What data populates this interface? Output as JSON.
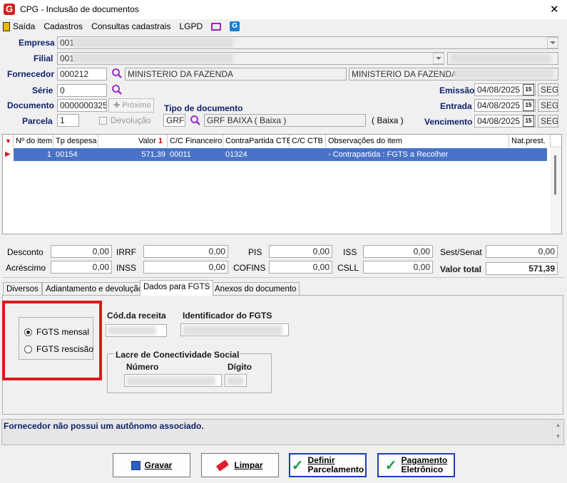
{
  "window": {
    "title": "CPG - Inclusão de documentos",
    "close": "✕"
  },
  "menu": {
    "items": [
      "Saída",
      "Cadastros",
      "Consultas cadastrais",
      "LGPD"
    ]
  },
  "form": {
    "empresa": {
      "label": "Empresa",
      "value": "001"
    },
    "filial": {
      "label": "Filial",
      "value": "001"
    },
    "fornecedor": {
      "label": "Fornecedor",
      "code": "000212",
      "name": "MINISTERIO DA FAZENDA",
      "name2": "MINISTERIO DA FAZENDA -"
    },
    "serie": {
      "label": "Série",
      "value": "0"
    },
    "documento": {
      "label": "Documento",
      "value": "0000000325",
      "proximo": "Próximo"
    },
    "parcela": {
      "label": "Parcela",
      "value": "1",
      "devolucao": "Devolução"
    },
    "tipo": {
      "label": "Tipo de documento",
      "code": "GRF",
      "desc": "GRF BAIXA ( Baixa )",
      "extra": "( Baixa )"
    },
    "emissao": {
      "label": "Emissão",
      "value": "04/08/2025",
      "day": "SEG"
    },
    "entrada": {
      "label": "Entrada",
      "value": "04/08/2025",
      "day": "SEG"
    },
    "vencimento": {
      "label": "Vencimento",
      "value": "04/08/2025",
      "day": "SEG"
    },
    "cal_icon": "15"
  },
  "grid": {
    "headers": [
      "Nº do item",
      "Tp despesa",
      "Valor",
      "C/C Financeiro",
      "ContraPartida CTB",
      "C/C CTB",
      "Observações do item",
      "Nat.prest."
    ],
    "sort_marker": "1",
    "rows": [
      [
        "1",
        "00154",
        "571,39",
        "00011",
        "01324",
        "",
        "- Contrapartida : FGTS a Recolher",
        ""
      ]
    ]
  },
  "totals": {
    "desconto": {
      "label": "Desconto",
      "value": "0,00"
    },
    "acrescimo": {
      "label": "Acréscimo",
      "value": "0,00"
    },
    "irrf": {
      "label": "IRRF",
      "value": "0,00"
    },
    "inss": {
      "label": "INSS",
      "value": "0,00"
    },
    "pis": {
      "label": "PIS",
      "value": "0,00"
    },
    "cofins": {
      "label": "COFINS",
      "value": "0,00"
    },
    "iss": {
      "label": "ISS",
      "value": "0,00"
    },
    "csll": {
      "label": "CSLL",
      "value": "0,00"
    },
    "sest": {
      "label": "Sest/Senat",
      "value": "0,00"
    },
    "total": {
      "label": "Valor total",
      "value": "571,39"
    }
  },
  "tabs": [
    "Diversos",
    "Adiantamento e devolução",
    "Dados para FGTS",
    "Anexos do documento"
  ],
  "fgts": {
    "mensal": "FGTS mensal",
    "rescisao": "FGTS rescisão",
    "cod_receita": "Cód.da receita",
    "identificador": "Identificador do FGTS",
    "lacre_title": "Lacre de Conectividade Social",
    "numero": "Número",
    "digito": "Dígito"
  },
  "status": {
    "message": "Fornecedor não possui um autônomo associado."
  },
  "buttons": {
    "gravar": "Gravar",
    "limpar": "Limpar",
    "definir1": "Definir",
    "definir2": "Parcelamento",
    "pagamento1": "Pagamento",
    "pagamento2": "Eletrônico"
  },
  "colors": {
    "accent": "#e02020",
    "navy": "#12206b",
    "selection": "#4a72c8",
    "highlight": "#e01818"
  }
}
